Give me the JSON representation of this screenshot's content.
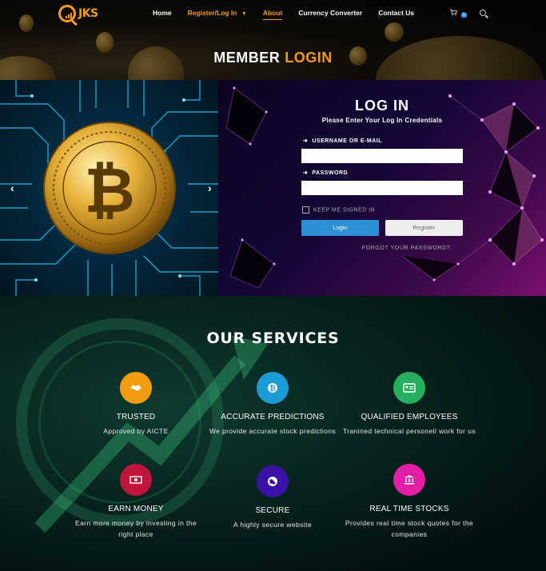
{
  "brand": {
    "logo_text": "JKS",
    "accent": "#f39c12"
  },
  "nav": {
    "items": [
      {
        "label": "Home"
      },
      {
        "label": "Register/Log In"
      },
      {
        "label": "About"
      },
      {
        "label": "Currency Converter"
      },
      {
        "label": "Contact Us"
      }
    ],
    "dropdown_icon": "chevron-down-icon",
    "cart_count": "0"
  },
  "page_title": {
    "part1": "MEMBER",
    "part2": "LOGIN"
  },
  "slider": {
    "prev": "‹",
    "next": "›"
  },
  "login": {
    "title": "LOG IN",
    "subtitle": "Please Enter Your Log In Credentials",
    "username_label": "USERNAME OR E-MAIL",
    "password_label": "PASSWORD",
    "username_value": "",
    "password_value": "",
    "keep_signed_in": "KEEP ME SIGNED IN",
    "login_button": "Login",
    "register_button": "Register",
    "forgot": "FORGOT YOUR PASSWORD?",
    "login_color": "#2d8fd5"
  },
  "services": {
    "title": "OUR SERVICES",
    "items": [
      {
        "name": "TRUSTED",
        "desc": "Approved by AICTE",
        "icon": "handshake-icon",
        "color": "#f39c12"
      },
      {
        "name": "ACCURATE PREDICTIONS",
        "desc": "We provide accurate stock predictions",
        "icon": "bitcoin-icon",
        "color": "#1d9bd6"
      },
      {
        "name": "QUALIFIED EMPLOYEES",
        "desc": "Tranined technical personell work for us",
        "icon": "id-card-icon",
        "color": "#27ae60"
      },
      {
        "name": "EARN MONEY",
        "desc": "Earn more money by investing in the right place",
        "icon": "money-icon",
        "color": "#c0143c"
      },
      {
        "name": "SECURE",
        "desc": "A highly secure website",
        "icon": "globe-icon",
        "color": "#3a12a8"
      },
      {
        "name": "REAL TIME STOCKS",
        "desc": "Provides real time stock quotes for the companies",
        "icon": "bank-icon",
        "color": "#e21fa6"
      }
    ]
  }
}
